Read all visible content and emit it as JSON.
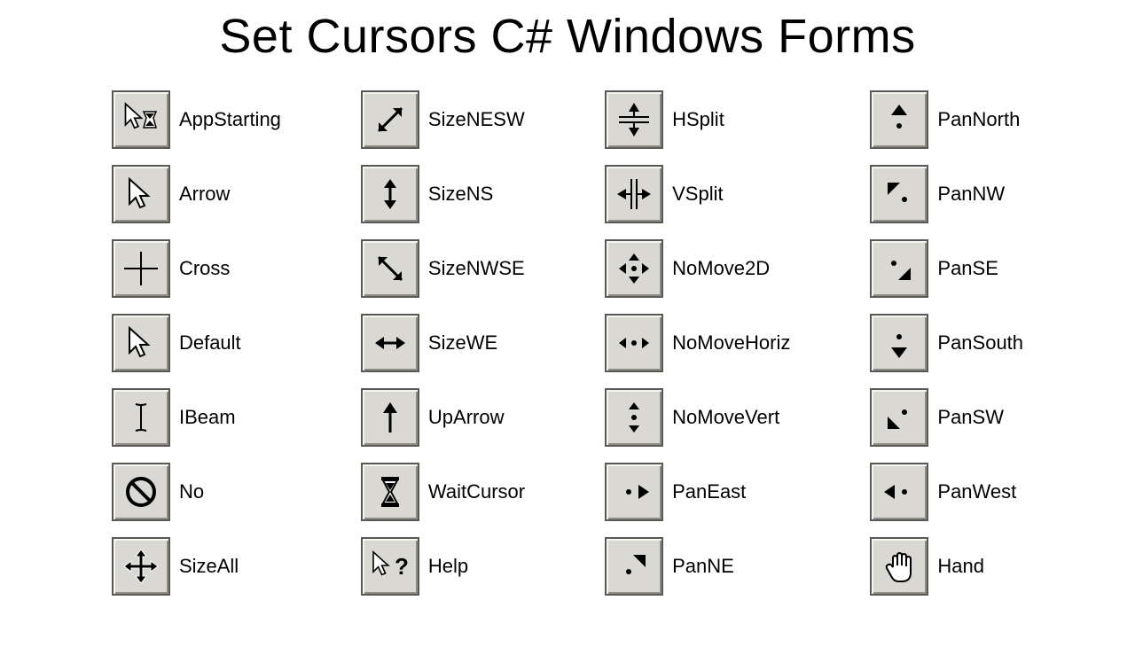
{
  "title": "Set Cursors C# Windows Forms",
  "columns": [
    [
      {
        "icon": "app-starting",
        "label": "AppStarting"
      },
      {
        "icon": "arrow",
        "label": "Arrow"
      },
      {
        "icon": "cross",
        "label": "Cross"
      },
      {
        "icon": "default",
        "label": "Default"
      },
      {
        "icon": "ibeam",
        "label": "IBeam"
      },
      {
        "icon": "no",
        "label": "No"
      },
      {
        "icon": "size-all",
        "label": "SizeAll"
      }
    ],
    [
      {
        "icon": "size-nesw",
        "label": "SizeNESW"
      },
      {
        "icon": "size-ns",
        "label": "SizeNS"
      },
      {
        "icon": "size-nwse",
        "label": "SizeNWSE"
      },
      {
        "icon": "size-we",
        "label": "SizeWE"
      },
      {
        "icon": "up-arrow",
        "label": "UpArrow"
      },
      {
        "icon": "wait-cursor",
        "label": "WaitCursor"
      },
      {
        "icon": "help",
        "label": "Help"
      }
    ],
    [
      {
        "icon": "h-split",
        "label": "HSplit"
      },
      {
        "icon": "v-split",
        "label": "VSplit"
      },
      {
        "icon": "no-move-2d",
        "label": "NoMove2D"
      },
      {
        "icon": "no-move-horiz",
        "label": "NoMoveHoriz"
      },
      {
        "icon": "no-move-vert",
        "label": "NoMoveVert"
      },
      {
        "icon": "pan-east",
        "label": "PanEast"
      },
      {
        "icon": "pan-ne",
        "label": "PanNE"
      }
    ],
    [
      {
        "icon": "pan-north",
        "label": "PanNorth"
      },
      {
        "icon": "pan-nw",
        "label": "PanNW"
      },
      {
        "icon": "pan-se",
        "label": "PanSE"
      },
      {
        "icon": "pan-south",
        "label": "PanSouth"
      },
      {
        "icon": "pan-sw",
        "label": "PanSW"
      },
      {
        "icon": "pan-west",
        "label": "PanWest"
      },
      {
        "icon": "hand",
        "label": "Hand"
      }
    ]
  ]
}
